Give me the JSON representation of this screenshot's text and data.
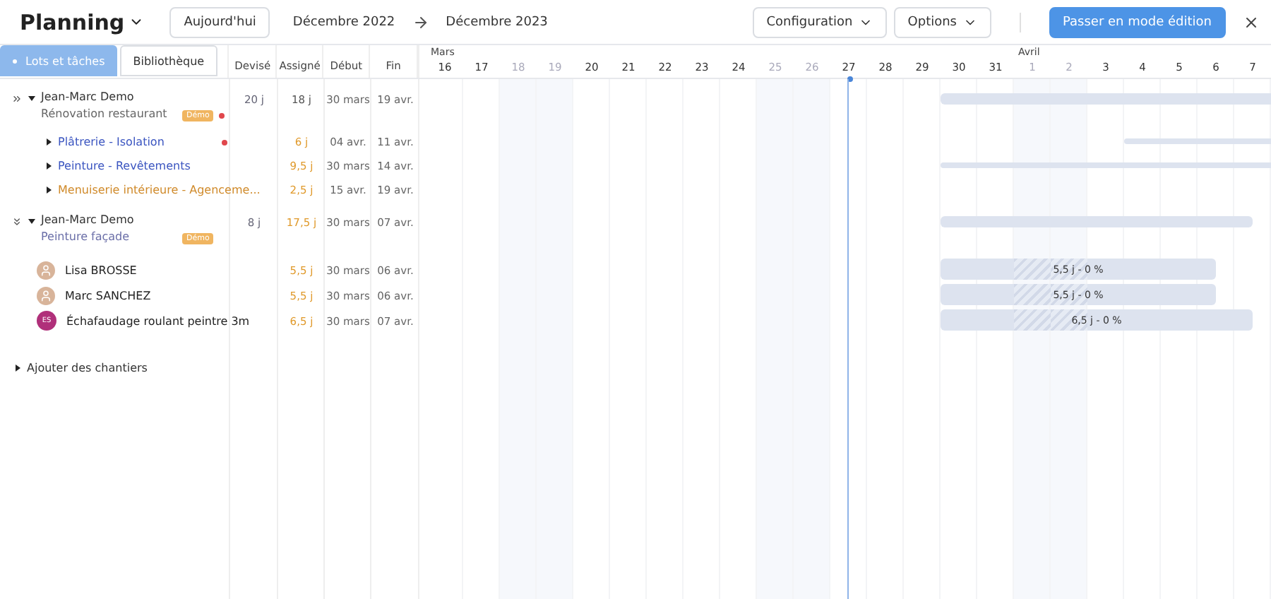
{
  "header": {
    "title": "Planning",
    "today_button": "Aujourd'hui",
    "date_from": "Décembre 2022",
    "date_to": "Décembre 2023",
    "menus": [
      "Configuration",
      "Options"
    ],
    "primary_button": "Passer en mode édition"
  },
  "tabs": [
    {
      "label": "Lots et tâches",
      "selected": true
    },
    {
      "label": "Bibliothèque",
      "selected": false
    }
  ],
  "columns": [
    "Devisé",
    "Assigné",
    "Début",
    "Fin"
  ],
  "days": [
    {
      "label": "16",
      "weekend": false,
      "month": "Mars",
      "today": false
    },
    {
      "label": "17",
      "weekend": false,
      "today": false
    },
    {
      "label": "18",
      "weekend": true,
      "today": false
    },
    {
      "label": "19",
      "weekend": true,
      "today": false
    },
    {
      "label": "20",
      "weekend": false,
      "today": false
    },
    {
      "label": "21",
      "weekend": false,
      "today": false
    },
    {
      "label": "22",
      "weekend": false,
      "today": false
    },
    {
      "label": "23",
      "weekend": false,
      "today": false
    },
    {
      "label": "24",
      "weekend": false,
      "today": false
    },
    {
      "label": "25",
      "weekend": true,
      "today": false
    },
    {
      "label": "26",
      "weekend": true,
      "today": false
    },
    {
      "label": "27",
      "weekend": false,
      "today": true
    },
    {
      "label": "28",
      "weekend": false,
      "today": false
    },
    {
      "label": "29",
      "weekend": false,
      "today": false
    },
    {
      "label": "30",
      "weekend": false,
      "today": false
    },
    {
      "label": "31",
      "weekend": false,
      "today": false
    },
    {
      "label": "1",
      "weekend": true,
      "month": "Avril",
      "today": false
    },
    {
      "label": "2",
      "weekend": true,
      "today": false
    },
    {
      "label": "3",
      "weekend": false,
      "today": false
    },
    {
      "label": "4",
      "weekend": false,
      "today": false
    },
    {
      "label": "5",
      "weekend": false,
      "today": false
    },
    {
      "label": "6",
      "weekend": false,
      "today": false
    },
    {
      "label": "7",
      "weekend": false,
      "today": false
    }
  ],
  "rows": [
    {
      "kind": "group",
      "expanded": true,
      "client": "Jean-Marc Demo",
      "project": "Rénovation restaurant",
      "badge": "Démo",
      "alert": true,
      "devise": "20 j",
      "assigne": "18 j",
      "over": false,
      "debut": "30 mars",
      "fin": "19 avr.",
      "bar": {
        "kind": "summary",
        "continues": true
      }
    },
    {
      "kind": "task",
      "name": "Plâtrerie - Isolation",
      "color": "#3b55c0",
      "alert": true,
      "assigne": "6 j",
      "over": true,
      "debut": "04 avr.",
      "fin": "11 avr.",
      "bar": {
        "kind": "thin",
        "continues": true
      }
    },
    {
      "kind": "task",
      "name": "Peinture - Revêtements",
      "color": "#3b55c0",
      "alert": false,
      "assigne": "9,5 j",
      "over": true,
      "debut": "30 mars",
      "fin": "14 avr.",
      "bar": {
        "kind": "thin",
        "continues": true
      }
    },
    {
      "kind": "task",
      "name": "Menuiserie intérieure - Agenceme...",
      "color": "#d08a2a",
      "alert": false,
      "assigne": "2,5 j",
      "over": true,
      "debut": "15 avr.",
      "fin": "19 avr."
    },
    {
      "kind": "group",
      "expanded": false,
      "client": "Jean-Marc Demo",
      "project": "Peinture façade",
      "badge": "Démo",
      "alert": false,
      "devise": "8 j",
      "assigne": "17,5 j",
      "over": true,
      "debut": "30 mars",
      "fin": "07 avr.",
      "bar": {
        "kind": "summary",
        "continues": false
      }
    },
    {
      "kind": "resource",
      "avatar": {
        "kind": "photo"
      },
      "name": "Lisa BROSSE",
      "assigne": "5,5 j",
      "over": true,
      "debut": "30 mars",
      "fin": "06 avr.",
      "bar": {
        "kind": "task",
        "continues": false,
        "label": "5,5 j - 0 %"
      }
    },
    {
      "kind": "resource",
      "avatar": {
        "kind": "photo"
      },
      "name": "Marc SANCHEZ",
      "assigne": "5,5 j",
      "over": true,
      "debut": "30 mars",
      "fin": "06 avr.",
      "bar": {
        "kind": "task",
        "continues": false,
        "label": "5,5 j - 0 %"
      }
    },
    {
      "kind": "resource",
      "avatar": {
        "kind": "initials",
        "initials": "ES"
      },
      "name": "Échafaudage roulant peintre 3m",
      "assigne": "6,5 j",
      "over": true,
      "debut": "30 mars",
      "fin": "07 avr.",
      "bar": {
        "kind": "task",
        "continues": false,
        "label": "6,5 j - 0 %"
      }
    },
    {
      "kind": "add",
      "name": "Ajouter des chantiers"
    }
  ]
}
